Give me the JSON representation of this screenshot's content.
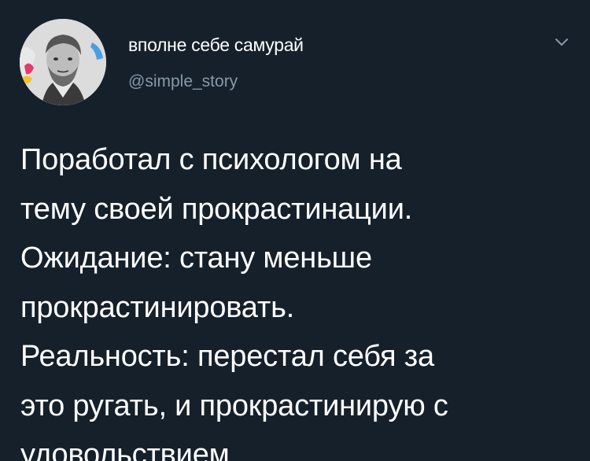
{
  "author": {
    "display_name": "вполне себе самурай",
    "handle": "@simple_story",
    "avatar_icon": "user-avatar-portrait"
  },
  "menu": {
    "icon": "chevron-down-icon"
  },
  "tweet": {
    "lines": [
      "Поработал с психологом на",
      "тему своей прокрастинации.",
      "Ожидание: стану меньше",
      "прокрастинировать.",
      "Реальность: перестал себя за",
      "это ругать, и прокрастинирую с",
      "удовольствием"
    ]
  },
  "colors": {
    "background": "#15202b",
    "text": "#ffffff",
    "secondary_text": "#8899a6"
  }
}
